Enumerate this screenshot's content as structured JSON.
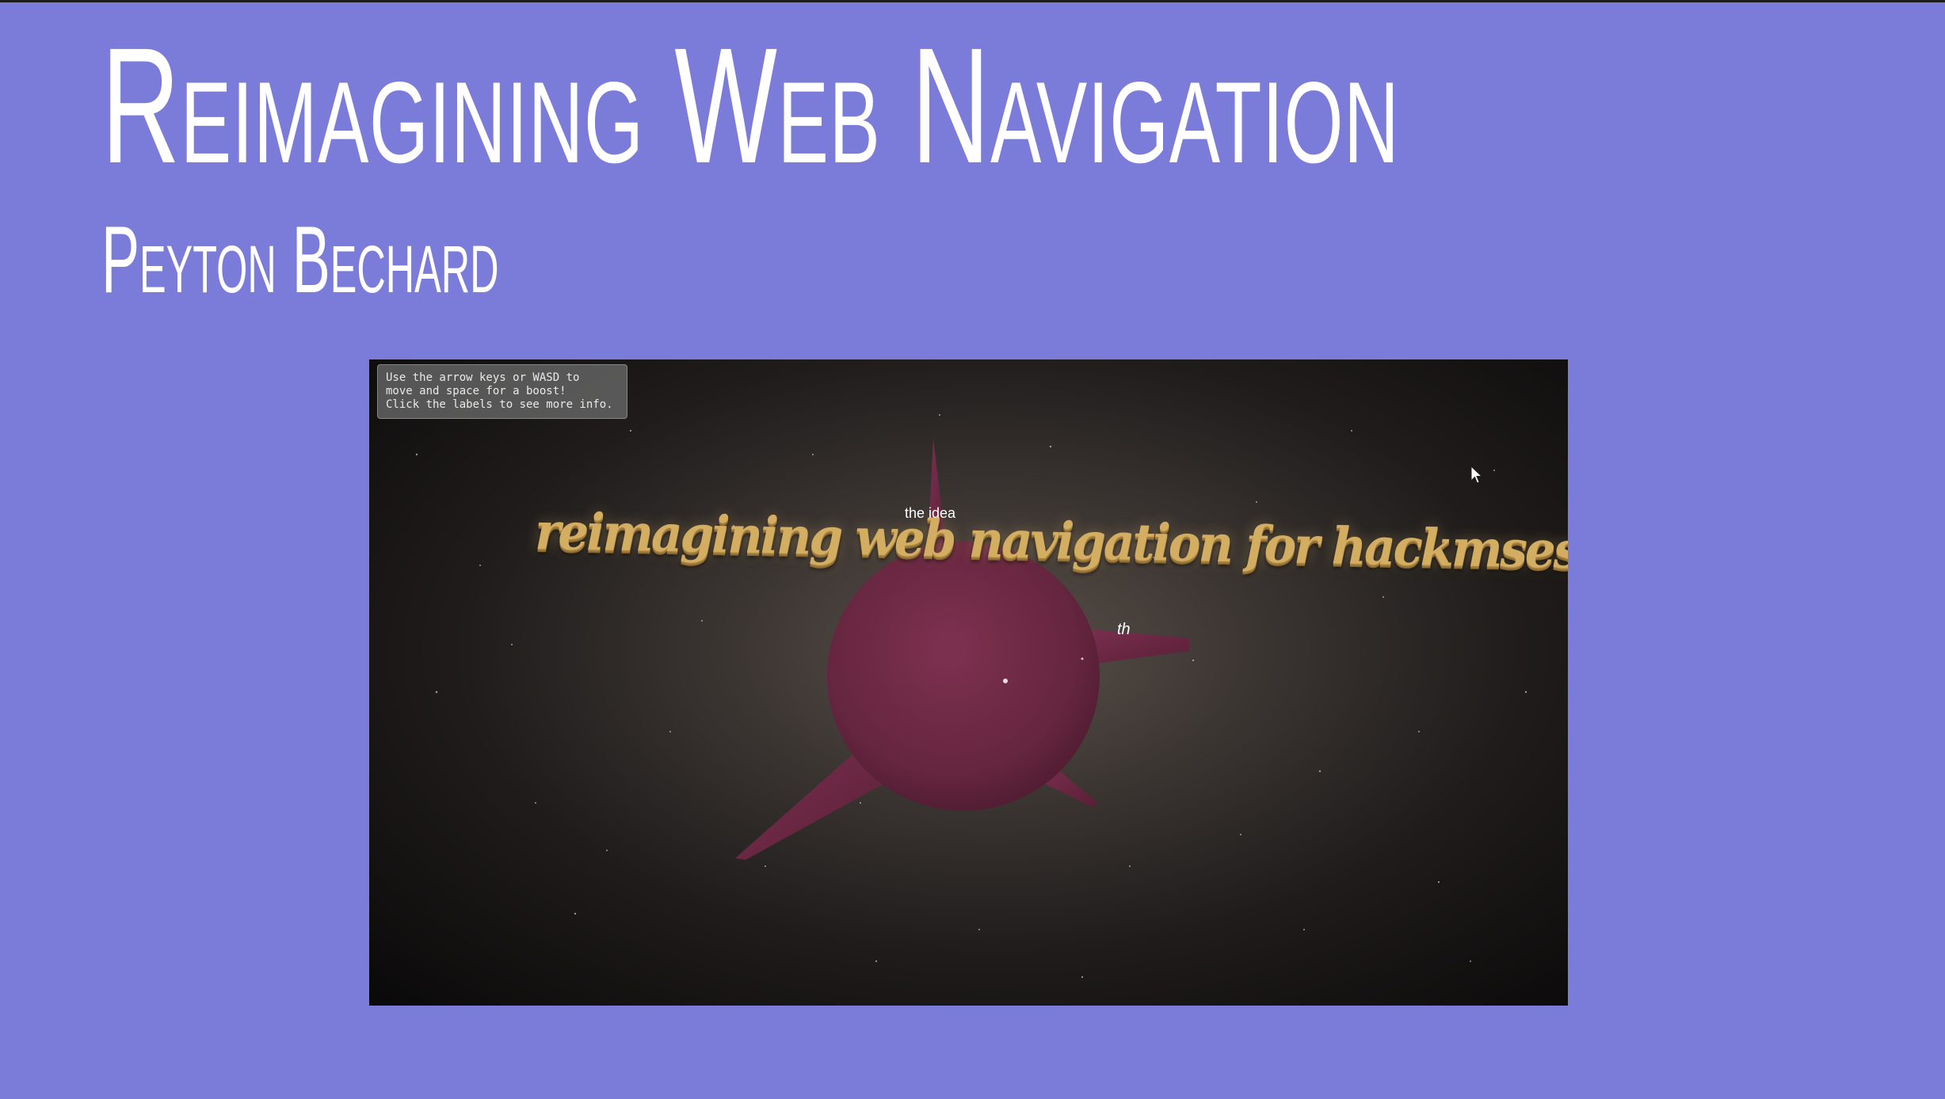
{
  "slide": {
    "title": "Reimagining Web Navigation",
    "subtitle": "Peyton Bechard",
    "background_color": "#7b7cda",
    "text_color": "#ffffff"
  },
  "video": {
    "instructions": [
      "Use the arrow keys or WASD to",
      "move and space for a boost!",
      "Click the labels to see more info."
    ],
    "label_idea": "the idea",
    "label_partial": "th",
    "banner_text": "reimagining web navigation for hackmses",
    "planet_color": "#6e2a44",
    "banner_color": "#d2ad62",
    "icons": {
      "cursor": "mouse-pointer-icon"
    }
  }
}
